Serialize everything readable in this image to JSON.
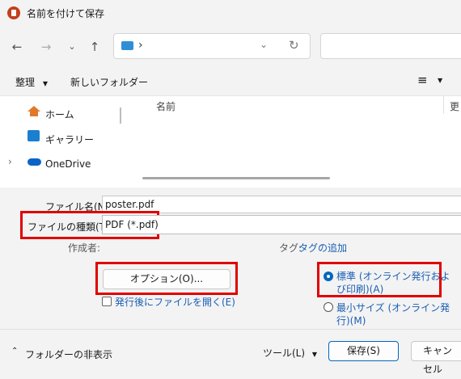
{
  "window": {
    "title": "名前を付けて保存"
  },
  "toolbar": {
    "organize_label": "整理",
    "new_folder_label": "新しいフォルダー"
  },
  "sidebar": {
    "items": [
      {
        "label": "ホーム"
      },
      {
        "label": "ギャラリー"
      },
      {
        "label": "OneDrive"
      }
    ]
  },
  "filelist": {
    "columns": [
      "名前",
      "更"
    ]
  },
  "form": {
    "filename_label": "ファイル名(N):",
    "filename_value": "poster.pdf",
    "filetype_label": "ファイルの種類(T):",
    "filetype_value": "PDF (*.pdf)",
    "author_label": "作成者:",
    "tag_label": "タグ:",
    "tag_add_label": "タグの追加",
    "options_button": "オプション(O)...",
    "open_after_label": "発行後にファイルを開く(E)",
    "radio_standard_line1": "標準 (オンライン発行およ",
    "radio_standard_line2": "び印刷)(A)",
    "radio_min_line1": "最小サイズ (オンライン発",
    "radio_min_line2": "行)(M)"
  },
  "footer": {
    "hide_folders_label": "フォルダーの非表示",
    "tools_label": "ツール(L)",
    "save_button": "保存(S)",
    "cancel_button": "キャンセル"
  },
  "colors": {
    "accent": "#0067c0",
    "highlight": "#e00000"
  }
}
